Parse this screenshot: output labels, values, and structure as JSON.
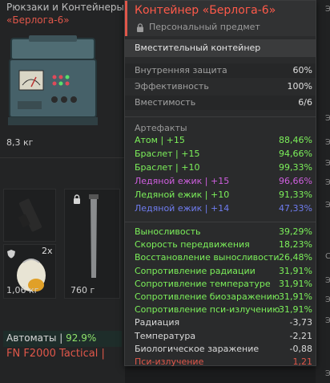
{
  "inventory": {
    "category_title": "Рюкзаки и Контейнеры",
    "category_sub": "«Берлога-6»",
    "container_weight": "8,3 кг",
    "stack_count": "2x",
    "item_weight_1": "1,06 кг",
    "item_weight_2": "760 г",
    "rifles_label": "Автоматы |",
    "rifles_pct": "92.9%",
    "weapon_name": "FN F2000 Tactical |"
  },
  "right_strip": {
    "letters": [
      "Э",
      "Р",
      "П",
      "Р",
      "Э",
      "Э",
      "Э",
      "Э",
      "Э",
      "С",
      "Э",
      "Э",
      "Э",
      "Э"
    ]
  },
  "tooltip": {
    "title": "Контейнер «Берлога-6»",
    "subtitle": "Персональный предмет",
    "type": "Вместительный контейнер",
    "base_stats": [
      {
        "label": "Внутренняя защита",
        "value": "60%"
      },
      {
        "label": "Эффективность",
        "value": "100%"
      },
      {
        "label": "Вместимость",
        "value": "6/6"
      }
    ],
    "artifacts_header": "Артефакты",
    "artifacts": [
      {
        "label": "Атом | +15",
        "value": "88,46%",
        "color": "#7cf05a"
      },
      {
        "label": "Браслет | +15",
        "value": "94,66%",
        "color": "#7cf05a"
      },
      {
        "label": "Браслет | +10",
        "value": "99,33%",
        "color": "#7cf05a"
      },
      {
        "label": "Ледяной ежик | +15",
        "value": "96,66%",
        "color": "#d05fe0"
      },
      {
        "label": "Ледяной ежик | +10",
        "value": "91,33%",
        "color": "#7cf05a"
      },
      {
        "label": "Ледяной ежик | +14",
        "value": "47,33%",
        "color": "#6f7cf0"
      }
    ],
    "effects": [
      {
        "label": "Выносливость",
        "value": "39,29%",
        "color": "#7cf05a"
      },
      {
        "label": "Скорость передвижения",
        "value": "18,23%",
        "color": "#7cf05a"
      },
      {
        "label": "Восстановление выносливости",
        "value": "26,48%",
        "color": "#7cf05a"
      },
      {
        "label": "Сопротивление радиации",
        "value": "31,91%",
        "color": "#7cf05a"
      },
      {
        "label": "Сопротивление температуре",
        "value": "31,91%",
        "color": "#7cf05a"
      },
      {
        "label": "Сопротивление биозаражению",
        "value": "31,91%",
        "color": "#7cf05a"
      },
      {
        "label": "Сопротивление пси-излучению",
        "value": "31,91%",
        "color": "#7cf05a"
      },
      {
        "label": "Радиация",
        "value": "-3,73",
        "color": "#d9d9d9"
      },
      {
        "label": "Температура",
        "value": "-2,21",
        "color": "#d9d9d9"
      },
      {
        "label": "Биологическое заражение",
        "value": "-0,88",
        "color": "#d9d9d9"
      },
      {
        "label": "Пси-излучение",
        "value": "1,21",
        "color": "#e0574a"
      }
    ]
  }
}
